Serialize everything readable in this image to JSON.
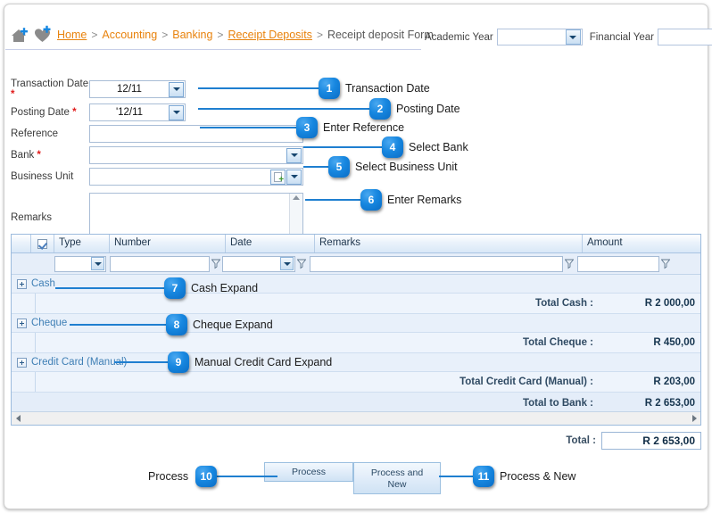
{
  "breadcrumb": {
    "home_icon": "home-plus-icon",
    "favorite_icon": "heart-plus-icon",
    "items": [
      {
        "label": "Home",
        "style": "link"
      },
      {
        "label": "Accounting",
        "style": "plain"
      },
      {
        "label": "Banking",
        "style": "plain"
      },
      {
        "label": "Receipt Deposits",
        "style": "link"
      },
      {
        "label": "Receipt deposit Form",
        "style": "current"
      }
    ],
    "separator": ">"
  },
  "year_selectors": {
    "academic": {
      "label": "Academic Year",
      "value": "",
      "icon": "chevron-down-icon"
    },
    "financial": {
      "label": "Financial Year",
      "value": "",
      "icon": "chevron-down-icon"
    }
  },
  "form": {
    "transaction_date": {
      "label": "Transaction Date",
      "required": "*",
      "value": "12/11",
      "icon": "calendar-dropdown-icon"
    },
    "posting_date": {
      "label": "Posting Date",
      "required": "*",
      "value": "'12/11",
      "icon": "calendar-dropdown-icon"
    },
    "reference": {
      "label": "Reference",
      "required": "",
      "value": ""
    },
    "bank": {
      "label": "Bank",
      "required": "*",
      "value": "",
      "icon": "chevron-down-icon"
    },
    "business_unit": {
      "label": "Business Unit",
      "required": "",
      "value": "",
      "lookup_icon": "page-add-icon",
      "icon": "chevron-down-icon"
    },
    "remarks": {
      "label": "Remarks",
      "value": "",
      "scroll_up_icon": "arrow-up-icon",
      "scroll_down_icon": "arrow-down-icon"
    }
  },
  "grid": {
    "select_all_icon": "checkbox-checked-icon",
    "columns": [
      {
        "key": "expand",
        "label": ""
      },
      {
        "key": "check",
        "label": ""
      },
      {
        "key": "type",
        "label": "Type"
      },
      {
        "key": "number",
        "label": "Number"
      },
      {
        "key": "date",
        "label": "Date"
      },
      {
        "key": "remarks",
        "label": "Remarks"
      },
      {
        "key": "amount",
        "label": "Amount"
      }
    ],
    "filter_row": {
      "type": "",
      "number": "",
      "date": "",
      "remarks": "",
      "amount": "",
      "filter_icon": "funnel-filter-icon",
      "dropdown_icon": "chevron-down-icon"
    },
    "groups": [
      {
        "expand_icon": "plus-expand-icon",
        "label": "Cash",
        "total_label": "Total Cash :",
        "total_value": "R 2 000,00"
      },
      {
        "expand_icon": "plus-expand-icon",
        "label": "Cheque",
        "total_label": "Total Cheque :",
        "total_value": "R 450,00"
      },
      {
        "expand_icon": "plus-expand-icon",
        "label": "Credit Card (Manual)",
        "total_label": "Total Credit Card (Manual) :",
        "total_value": "R 203,00"
      }
    ],
    "bank_total": {
      "label": "Total to Bank :",
      "value": "R 2 653,00"
    },
    "hscroll": {
      "left_icon": "arrow-left-icon",
      "right_icon": "arrow-right-icon"
    }
  },
  "grand_total": {
    "label": "Total :",
    "value": "R 2 653,00"
  },
  "buttons": {
    "process": "Process",
    "process_and_new_line1": "Process and",
    "process_and_new_line2": "New"
  },
  "callouts": [
    {
      "num": "1",
      "text": "Transaction Date"
    },
    {
      "num": "2",
      "text": "Posting Date"
    },
    {
      "num": "3",
      "text": "Enter Reference"
    },
    {
      "num": "4",
      "text": "Select Bank"
    },
    {
      "num": "5",
      "text": "Select Business Unit"
    },
    {
      "num": "6",
      "text": "Enter Remarks"
    },
    {
      "num": "7",
      "text": "Cash Expand"
    },
    {
      "num": "8",
      "text": "Cheque Expand"
    },
    {
      "num": "9",
      "text": "Manual Credit Card Expand"
    },
    {
      "num": "10",
      "text": "Process"
    },
    {
      "num": "11",
      "text": "Process & New"
    }
  ],
  "colors": {
    "accent_blue": "#1787e0",
    "crumb_orange": "#E8820C",
    "required_red": "#e01b1b",
    "grid_blue": "#3f7fb5"
  }
}
